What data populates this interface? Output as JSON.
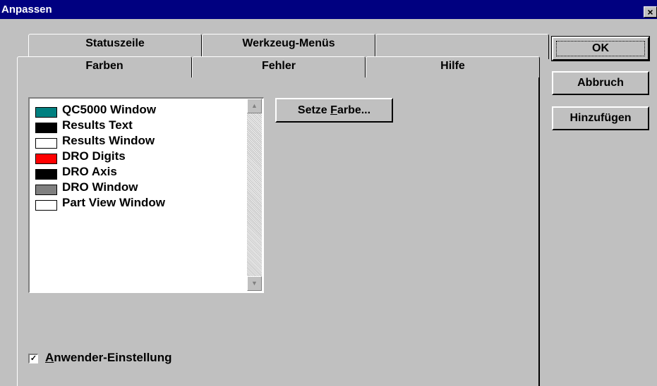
{
  "window": {
    "title": "Anpassen",
    "close_label": "×"
  },
  "tabs": {
    "back_row": [
      {
        "label": "Statuszeile"
      },
      {
        "label": "Werkzeug-Menüs"
      },
      {
        "label": ""
      }
    ],
    "front_row": [
      {
        "label": "Farben",
        "selected": true
      },
      {
        "label": "Fehler"
      },
      {
        "label": "Hilfe"
      }
    ]
  },
  "color_list": {
    "items": [
      {
        "label": "QC5000 Window",
        "color": "#008080"
      },
      {
        "label": "Results Text",
        "color": "#000000"
      },
      {
        "label": "Results Window",
        "color": "#ffffff"
      },
      {
        "label": "DRO Digits",
        "color": "#ff0000"
      },
      {
        "label": "DRO Axis",
        "color": "#000000"
      },
      {
        "label": "DRO Window",
        "color": "#808080"
      },
      {
        "label": "Part View Window",
        "color": "#ffffff"
      }
    ],
    "scroll_up_icon": "arrow-up-icon",
    "scroll_down_icon": "arrow-down-icon"
  },
  "set_color_button": {
    "prefix": "Setze ",
    "mnemonic": "F",
    "suffix": "arbe..."
  },
  "buttons": {
    "ok": "OK",
    "cancel": "Abbruch",
    "add": "Hinzufügen"
  },
  "user_setting": {
    "mnemonic": "A",
    "rest": "nwender-Einstellung",
    "checked": true
  }
}
